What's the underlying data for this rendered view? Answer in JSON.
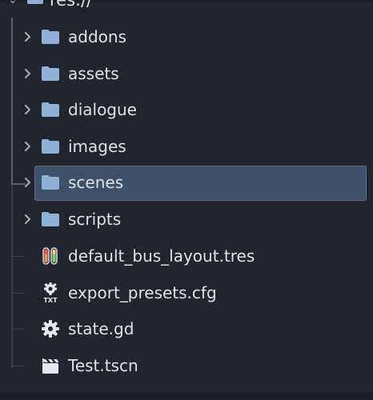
{
  "root": {
    "label": "res://",
    "arrow_icon": "chevron-down-icon",
    "icon": "folder-icon"
  },
  "items": [
    {
      "label": "addons",
      "type": "folder",
      "icon": "folder-icon",
      "expandable": true,
      "selected": false
    },
    {
      "label": "assets",
      "type": "folder",
      "icon": "folder-icon",
      "expandable": true,
      "selected": false
    },
    {
      "label": "dialogue",
      "type": "folder",
      "icon": "folder-icon",
      "expandable": true,
      "selected": false
    },
    {
      "label": "images",
      "type": "folder",
      "icon": "folder-icon",
      "expandable": true,
      "selected": false
    },
    {
      "label": "scenes",
      "type": "folder",
      "icon": "folder-icon",
      "expandable": true,
      "selected": true
    },
    {
      "label": "scripts",
      "type": "folder",
      "icon": "folder-icon",
      "expandable": true,
      "selected": false
    },
    {
      "label": "default_bus_layout.tres",
      "type": "file",
      "icon": "audio-bus-layout-icon",
      "expandable": false,
      "selected": false
    },
    {
      "label": "export_presets.cfg",
      "type": "file",
      "icon": "text-config-gear-icon",
      "expandable": false,
      "selected": false
    },
    {
      "label": "state.gd",
      "type": "file",
      "icon": "gear-script-icon",
      "expandable": false,
      "selected": false
    },
    {
      "label": "Test.tscn",
      "type": "file",
      "icon": "clapperboard-scene-icon",
      "expandable": false,
      "selected": false
    }
  ],
  "colors": {
    "background": "#20252e",
    "text": "#dfe2e7",
    "folder": "#8fb1d8",
    "selection": "#3d5268",
    "selection_border": "#5a708a"
  }
}
